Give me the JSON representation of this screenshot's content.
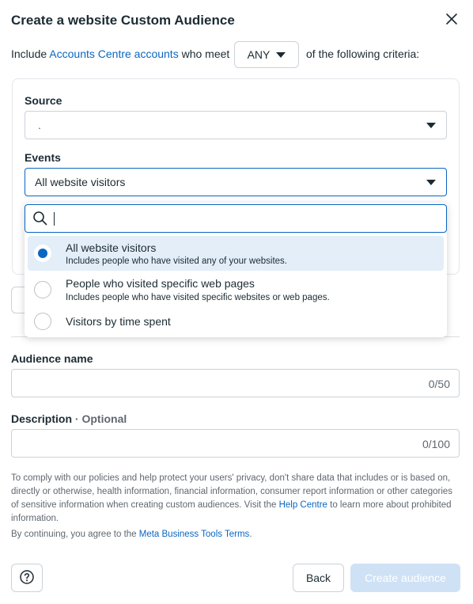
{
  "dialog": {
    "title": "Create a website Custom Audience",
    "close_icon": "close-icon"
  },
  "criteria": {
    "prefix": "Include",
    "link": "Accounts Centre accounts",
    "mid": "who meet",
    "match_value": "ANY",
    "suffix": "of the following criteria:"
  },
  "source": {
    "label": "Source",
    "value": "."
  },
  "events": {
    "label": "Events",
    "value": "All website visitors"
  },
  "dropdown": {
    "search_icon": "search-icon",
    "search_value": "",
    "options": [
      {
        "title": "All website visitors",
        "subtitle": "Includes people who have visited any of your websites.",
        "selected": true
      },
      {
        "title": "People who visited specific web pages",
        "subtitle": "Includes people who have visited specific websites or web pages.",
        "selected": false
      },
      {
        "title": "Visitors by time spent",
        "subtitle": "",
        "selected": false
      }
    ]
  },
  "audience_name": {
    "label": "Audience name",
    "value": "",
    "counter": "0/50"
  },
  "description": {
    "label": "Description",
    "separator": " · ",
    "optional": "Optional",
    "value": "",
    "counter": "0/100"
  },
  "legal": {
    "text_before": "To comply with our policies and help protect your users' privacy, don't share data that includes or is based on, directly or otherwise, health information, financial information, consumer report information or other categories of sensitive information when creating custom audiences. Visit the ",
    "link": "Help Centre",
    "text_after": " to learn more about prohibited information.",
    "agree_before": "By continuing, you agree to the ",
    "agree_link": "Meta Business Tools Terms",
    "agree_after": "."
  },
  "footer": {
    "help_icon": "question-mark-icon",
    "back_label": "Back",
    "create_label": "Create audience"
  },
  "colors": {
    "accent": "#0a66c2",
    "text": "#1c2b33",
    "muted": "#606770",
    "selected_bg": "#e3eef8",
    "disabled_button": "#cfe1f5"
  }
}
